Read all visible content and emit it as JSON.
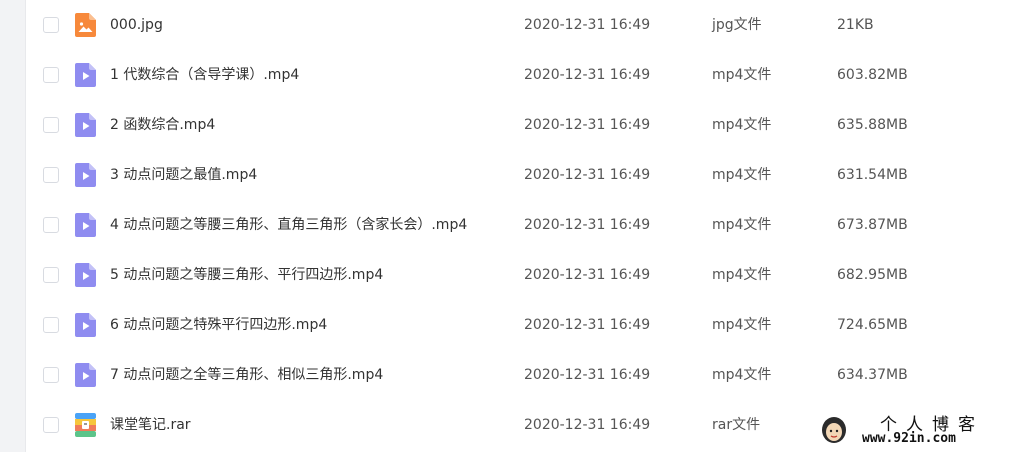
{
  "files": [
    {
      "name": "000.jpg",
      "date": "2020-12-31 16:49",
      "type": "jpg文件",
      "size": "21KB",
      "icon": "image-file-icon"
    },
    {
      "name": "1 代数综合（含导学课）.mp4",
      "date": "2020-12-31 16:49",
      "type": "mp4文件",
      "size": "603.82MB",
      "icon": "video-file-icon"
    },
    {
      "name": "2 函数综合.mp4",
      "date": "2020-12-31 16:49",
      "type": "mp4文件",
      "size": "635.88MB",
      "icon": "video-file-icon"
    },
    {
      "name": "3 动点问题之最值.mp4",
      "date": "2020-12-31 16:49",
      "type": "mp4文件",
      "size": "631.54MB",
      "icon": "video-file-icon"
    },
    {
      "name": "4 动点问题之等腰三角形、直角三角形（含家长会）.mp4",
      "date": "2020-12-31 16:49",
      "type": "mp4文件",
      "size": "673.87MB",
      "icon": "video-file-icon"
    },
    {
      "name": "5 动点问题之等腰三角形、平行四边形.mp4",
      "date": "2020-12-31 16:49",
      "type": "mp4文件",
      "size": "682.95MB",
      "icon": "video-file-icon"
    },
    {
      "name": "6 动点问题之特殊平行四边形.mp4",
      "date": "2020-12-31 16:49",
      "type": "mp4文件",
      "size": "724.65MB",
      "icon": "video-file-icon"
    },
    {
      "name": "7 动点问题之全等三角形、相似三角形.mp4",
      "date": "2020-12-31 16:49",
      "type": "mp4文件",
      "size": "634.37MB",
      "icon": "video-file-icon"
    },
    {
      "name": "课堂笔记.rar",
      "date": "2020-12-31 16:49",
      "type": "rar文件",
      "size": "",
      "icon": "archive-file-icon"
    }
  ],
  "watermark": {
    "title": "个人博客",
    "url": "www.92in.com"
  },
  "colors": {
    "image_icon": "#f7893b",
    "video_icon": "#8f8cf0",
    "checkbox_border": "#d8dbe1"
  }
}
